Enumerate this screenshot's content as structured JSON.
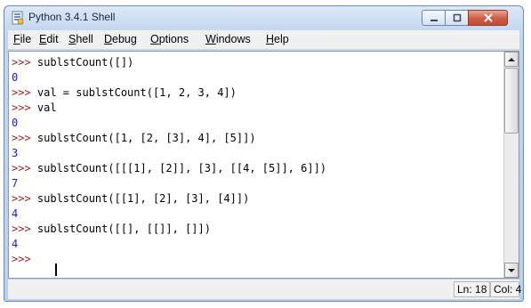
{
  "window": {
    "title": "Python 3.4.1 Shell"
  },
  "menu": {
    "items": [
      {
        "label": "File"
      },
      {
        "label": "Edit"
      },
      {
        "label": "Shell"
      },
      {
        "label": "Debug"
      },
      {
        "label": "Options"
      },
      {
        "label": "Windows"
      },
      {
        "label": "Help"
      }
    ]
  },
  "shell": {
    "lines": [
      {
        "prompt": ">>> ",
        "text": "sublstCount([])"
      },
      {
        "output": "0"
      },
      {
        "prompt": ">>> ",
        "text": "val = sublstCount([1, 2, 3, 4])"
      },
      {
        "prompt": ">>> ",
        "text": "val"
      },
      {
        "output": "0"
      },
      {
        "prompt": ">>> ",
        "text": "sublstCount([1, [2, [3], 4], [5]])"
      },
      {
        "output": "3"
      },
      {
        "prompt": ">>> ",
        "text": "sublstCount([[[1], [2]], [3], [[4, [5]], 6]])"
      },
      {
        "output": "7"
      },
      {
        "prompt": ">>> ",
        "text": "sublstCount([[1], [2], [3], [4]])"
      },
      {
        "output": "4"
      },
      {
        "prompt": ">>> ",
        "text": "sublstCount([[], [[]], []])"
      },
      {
        "output": "4"
      },
      {
        "prompt": ">>> ",
        "text": ""
      }
    ]
  },
  "status": {
    "line": "Ln: 18",
    "column": "Col: 4"
  },
  "colors": {
    "prompt": "#a02020",
    "output": "#1a1ae6",
    "code": "#000000"
  }
}
